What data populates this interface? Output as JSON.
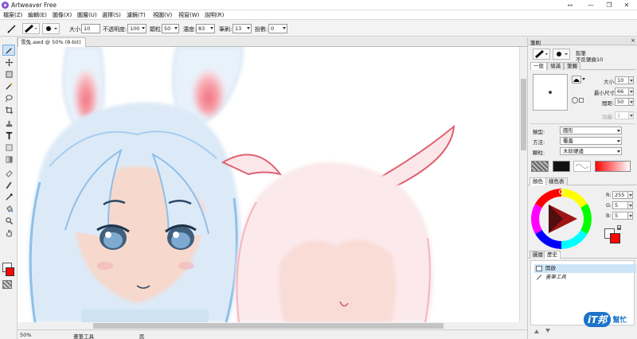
{
  "window": {
    "title": "Artweaver Free",
    "controls": [
      "⭤",
      "—",
      "❐",
      "✕"
    ]
  },
  "menu": [
    "檔案(Z)",
    "編輯(E)",
    "圖像(X)",
    "圖層(U)",
    "選擇(S)",
    "濾鏡(T)",
    "視圖(V)",
    "視窗(W)",
    "說明(R)"
  ],
  "options": {
    "size_label": "大小:",
    "size_value": "10",
    "opacity_label": "不透明度:",
    "opacity_value": "100",
    "grain_label": "顆粒:",
    "grain_value": "50",
    "flow_label": "濃度:",
    "flow_value": "83",
    "jitter_label": "筆刷:",
    "jitter_value": "13",
    "steps_label": "扮數:",
    "steps_value": "0"
  },
  "document": {
    "tab_label": "雪兔.awd @ 50% (8-bit)",
    "tab_close": "×",
    "zoom": "50%",
    "tool_status": "畫筆工具",
    "status_extra": "民"
  },
  "brush_panel": {
    "title": "筆刷",
    "close": "×",
    "category": "鉛筆",
    "variant": "不反鋸齒10",
    "tabs": [
      "一般",
      "填滿",
      "筆觸"
    ],
    "size_label": "大小:",
    "size_value": "10",
    "min_size_label": "最小尺寸:",
    "min_size_value": "66",
    "spacing_label": "間距:",
    "spacing_value": "50",
    "angle_label": "功能:",
    "angle_value": "1",
    "shape_label": "類型:",
    "shape_value": "圓形",
    "method_label": "方法:",
    "method_value": "覆蓋",
    "source_label": "顆粒:",
    "source_value": "木紋硬邊"
  },
  "color_panel": {
    "tabs": [
      "顏色",
      "樣色表"
    ],
    "r_label": "R:",
    "r_value": "255",
    "g_label": "G:",
    "g_value": "5",
    "b_label": "B:",
    "b_value": "5",
    "primary": "#ff0505"
  },
  "layer_panel": {
    "tabs": [
      "圖層",
      "歷史"
    ],
    "history": [
      "開啟",
      "畫筆工具"
    ]
  },
  "watermark": {
    "text": "iT邦",
    "sub": "幫忙"
  }
}
